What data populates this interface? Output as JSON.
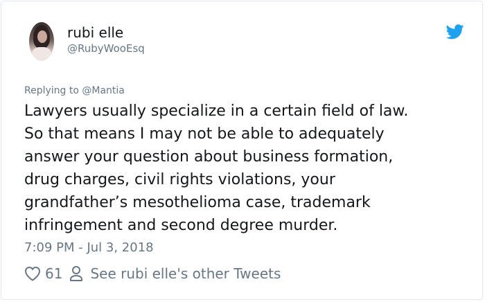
{
  "author": {
    "display_name": "rubi elle",
    "handle": "@RubyWooEsq"
  },
  "tweet": {
    "replying_to": "Replying to @Mantia",
    "text": "Lawyers usually specialize in a certain field of law.\nSo that means I may not be able to adequately\nanswer your question about business formation,\ndrug charges, civil rights violations, your\ngrandfather’s mesothelioma case, trademark\ninfringement and second degree murder.",
    "timestamp": "7:09 PM - Jul 3, 2018"
  },
  "actions": {
    "like_count": "61",
    "other_tweets_label": "See rubi elle's other Tweets"
  },
  "icons": {
    "brand": "twitter-bird-icon",
    "like": "heart-icon",
    "profile": "person-icon"
  },
  "colors": {
    "brand": "#1da1f2",
    "text": "#14171a",
    "muted": "#657786",
    "border": "#e1e8ed"
  }
}
